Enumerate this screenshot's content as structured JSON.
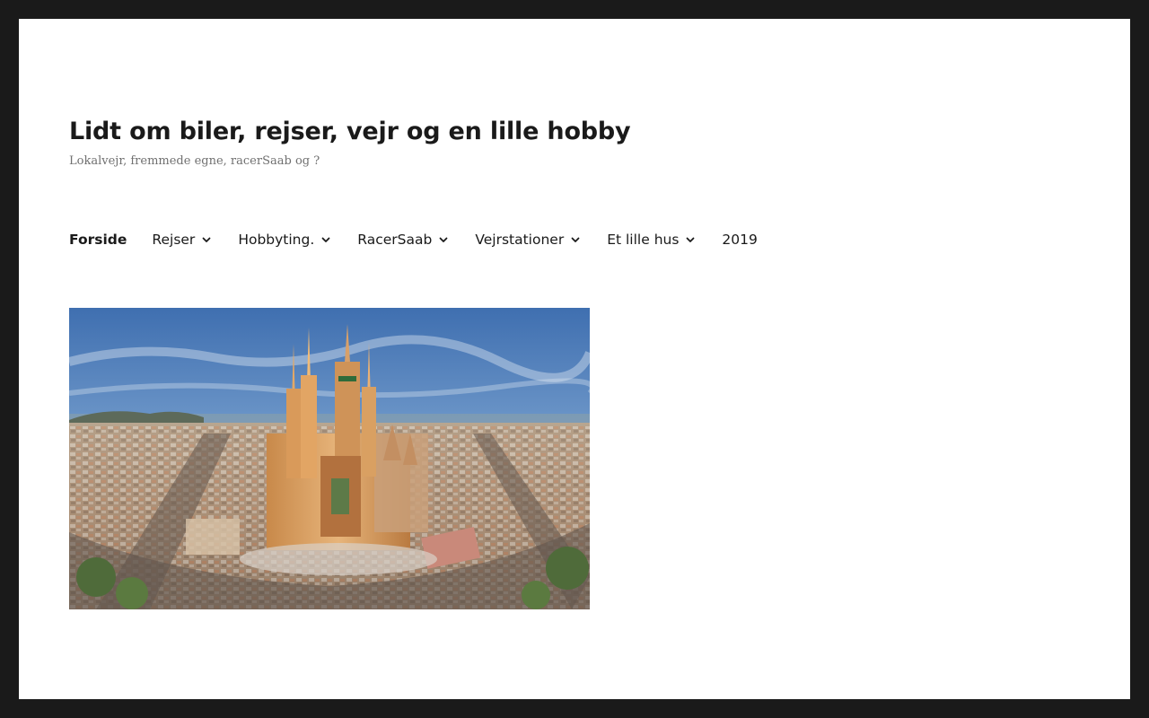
{
  "site": {
    "title": "Lidt om biler, rejser, vejr og en lille hobby",
    "description": "Lokalvejr, fremmede egne, racerSaab og ?"
  },
  "nav": {
    "items": [
      {
        "label": "Forside",
        "current": true,
        "has_submenu": false
      },
      {
        "label": "Rejser",
        "has_submenu": true
      },
      {
        "label": "Hobbyting.",
        "has_submenu": true
      },
      {
        "label": "RacerSaab",
        "has_submenu": true
      },
      {
        "label": "Vejrstationer",
        "has_submenu": true
      },
      {
        "label": "Et lille hus",
        "has_submenu": true
      },
      {
        "label": "2019",
        "has_submenu": false
      }
    ]
  },
  "featured_image": {
    "icon": "cathedral-aerial-photo"
  },
  "colors": {
    "frame": "#1a1a1a",
    "page": "#ffffff",
    "text": "#1a1a1a",
    "muted": "#707070"
  }
}
